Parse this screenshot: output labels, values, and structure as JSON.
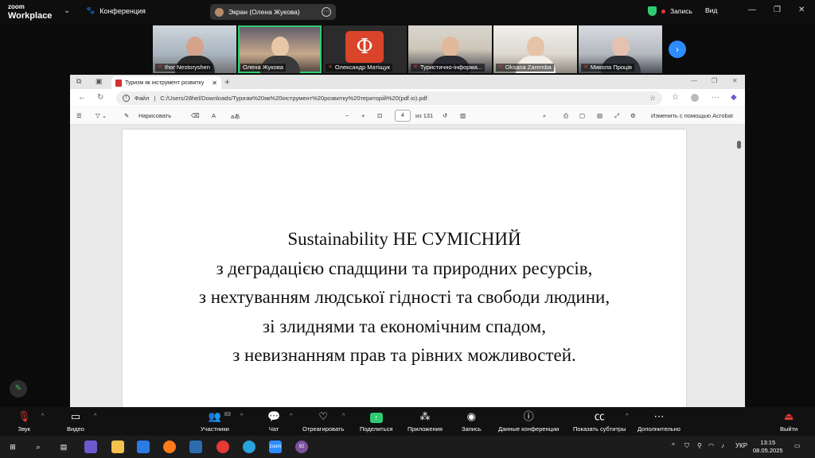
{
  "zoom": {
    "logo_line1": "zoom",
    "logo_line2": "Workplace",
    "meeting_label": "Конференция",
    "share_label": "Экран (Олена Жукова)",
    "record_label": "Запись",
    "view_label": "Вид"
  },
  "participants": [
    {
      "name": "Ihor Nestoryshen"
    },
    {
      "name": "Олена Жукова"
    },
    {
      "name": "Олександр Матіщук"
    },
    {
      "name": "Туристично-інформа..."
    },
    {
      "name": "Oksana Zaremba"
    },
    {
      "name": "Микола Проців"
    }
  ],
  "browser": {
    "tab_title": "Туризм як інструмент розвитку",
    "address_prefix": "Файл",
    "address": "C:/Users/28hel/Downloads/Туризм%20як%20інструмент%20розвитку%20територій%20(pdf.io).pdf",
    "draw_label": "Нарисовать",
    "page_current": "4",
    "page_total": "из 131",
    "acrobat_label": "Изменить с помощью Acrobat"
  },
  "slide": {
    "lines": [
      "Sustainability НЕ СУМІСНИЙ",
      "з деградацією спадщини та природних ресурсів,",
      "з нехтуванням людської гідності та свободи людини,",
      "зі злиднями та економічним спадом,",
      "з невизнанням прав та рівних можливостей."
    ]
  },
  "controls": {
    "audio": "Звук",
    "video": "Видео",
    "participants": "Участники",
    "participants_count": "83",
    "chat": "Чат",
    "react": "Отреагировать",
    "share": "Поделиться",
    "apps": "Приложения",
    "record": "Запись",
    "meeting_info": "Данные конференции",
    "captions": "Показать субтитры",
    "more": "Дополнительно",
    "leave": "Выйти"
  },
  "taskbar": {
    "lang": "УКР",
    "time": "13:15",
    "date": "08.05.2025",
    "viber_badge": "92"
  },
  "colors": {
    "zoom_blue": "#2d8cff",
    "share_green": "#2ecc71",
    "record_red": "#e53935"
  }
}
